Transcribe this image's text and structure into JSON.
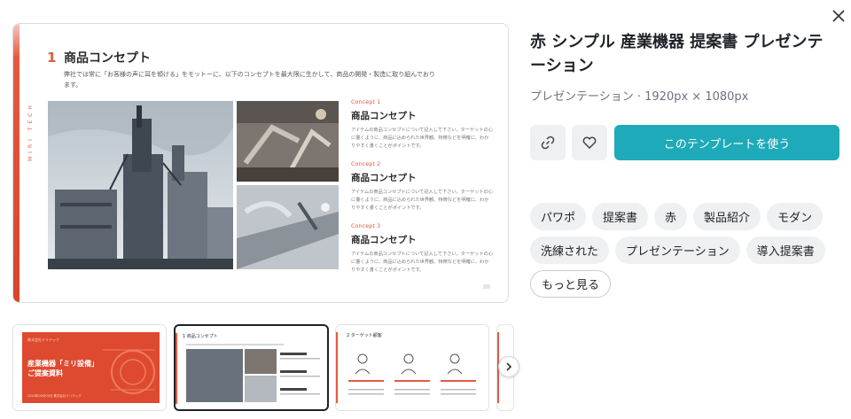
{
  "preview": {
    "vertical_label": "MIRI TECH",
    "slide_number": "1",
    "slide_title": "商品コンセプト",
    "slide_desc": "弊社では常に「お客様の声に耳を傾ける」をモットーに、以下のコンセプトを最大限に生かして、商品の開発・製造に取り組んでおります。",
    "concepts": [
      {
        "label": "Concept 1",
        "title": "商品コンセプト",
        "body": "アイテムの商品コンセプトについて記入して下さい。ターゲットの心に響くように、商品に込められた世界観、特徴などを明確に、わかりやすく書くことがポイントです。"
      },
      {
        "label": "Concept 2",
        "title": "商品コンセプト",
        "body": "アイテムの商品コンセプトについて記入して下さい。ターゲットの心に響くように、商品に込められた世界観、特徴などを明確に、わかりやすく書くことがポイントです。"
      },
      {
        "label": "Concept 3",
        "title": "商品コンセプト",
        "body": "アイテムの商品コンセプトについて記入して下さい。ターゲットの心に響くように、商品に込められた世界観、特徴などを明確に、わかりやすく書くことがポイントです。"
      }
    ]
  },
  "detail": {
    "title": "赤 シンプル 産業機器 提案書 プレゼンテーション",
    "meta": "プレゼンテーション · 1920px × 1080px",
    "use_button": "このテンプレートを使う",
    "icons": {
      "link": "link-icon",
      "favorite": "heart-icon",
      "close": "close-icon"
    },
    "tags": [
      "パワポ",
      "提案書",
      "赤",
      "製品紹介",
      "モダン",
      "洗練された",
      "プレゼンテーション",
      "導入提案書"
    ],
    "more_tags": "もっと見る"
  },
  "thumbnails": {
    "cover": {
      "brand": "株式会社ミリテック",
      "title_line1": "産業機器「ミリ設備」",
      "title_line2": "ご提案資料",
      "footer": "2024年00月00日  株式会社ミリテック"
    },
    "slide2_title": "1 商品コンセプト",
    "slide3_title": "2 ターゲット顧客",
    "slide3_labels": [
      "10代の若者",
      "20〜30代の社会人",
      "40〜50代の中年層"
    ]
  },
  "colors": {
    "accent": "#e55a3f",
    "primary_button": "#1eaab9",
    "tag_bg": "#eef0f2"
  }
}
